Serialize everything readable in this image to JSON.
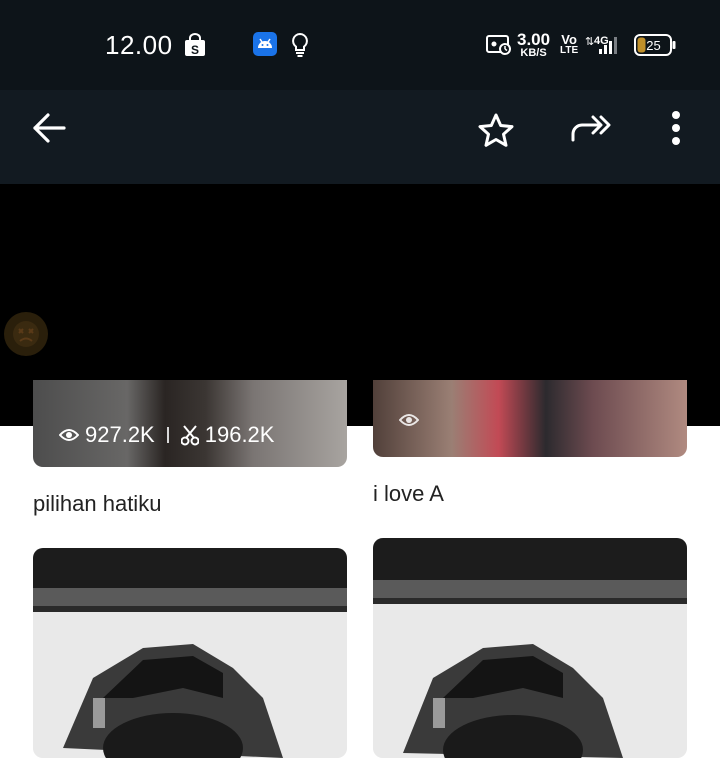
{
  "status_bar": {
    "time": "12.00",
    "net_speed_value": "3.00",
    "net_speed_unit": "KB/S",
    "volte_top": "Vo",
    "volte_bottom": "LTE",
    "network": "4G",
    "battery": "25",
    "icons": [
      "shopee-bag-icon",
      "android-notification-icon",
      "bulb-icon",
      "screen-record-icon",
      "signal-icon",
      "battery-icon"
    ]
  },
  "app_bar": {
    "icons": [
      "back-arrow-icon",
      "star-icon",
      "share-icon",
      "more-vert-icon"
    ]
  },
  "grid": {
    "items": [
      {
        "views": "927.2K",
        "uses": "196.2K",
        "caption": "pilihan hatiku"
      },
      {
        "caption": "i love A"
      },
      {
        "caption": ""
      },
      {
        "caption": ""
      }
    ]
  },
  "colors": {
    "status_bar_bg": "#0d1419",
    "app_bar_bg": "#121a21",
    "overlay": "#000000",
    "shopee_orange": "#ffffff",
    "android_badge": "#1a73e8"
  }
}
